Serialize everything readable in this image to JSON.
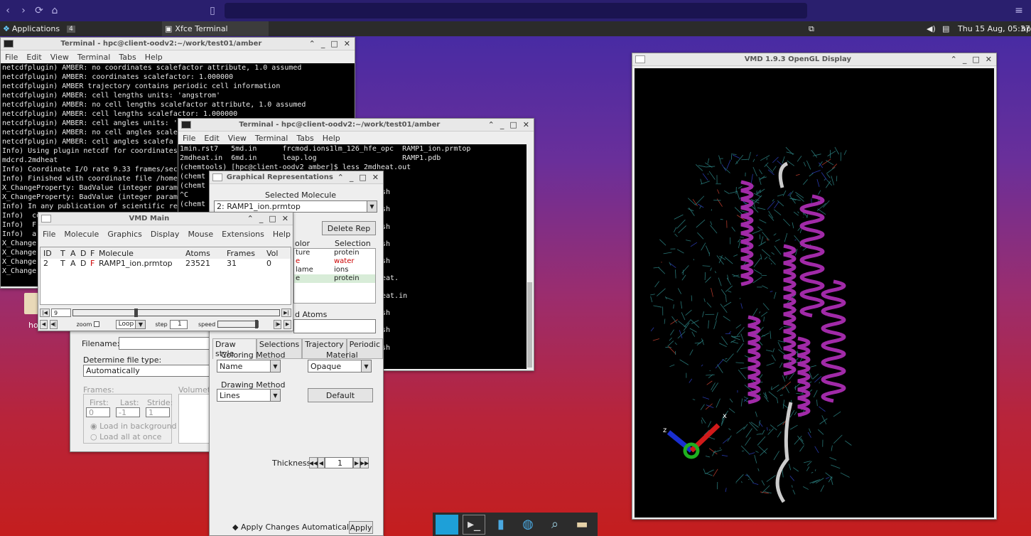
{
  "panel": {
    "apps": "Applications",
    "xfce": "Xfce Terminal",
    "clock": "Thu 15 Aug, 05:37",
    "user": "hpc",
    "badge": "4"
  },
  "term1": {
    "title": "Terminal - hpc@client-oodv2:~/work/test01/amber",
    "menu": [
      "File",
      "Edit",
      "View",
      "Terminal",
      "Tabs",
      "Help"
    ],
    "lines": [
      "netcdfplugin) AMBER: no coordinates scalefactor attribute, 1.0 assumed",
      "netcdfplugin) AMBER: coordinates scalefactor: 1.000000",
      "netcdfplugin) AMBER trajectory contains periodic cell information",
      "netcdfplugin) AMBER: cell lengths units: 'angstrom'",
      "netcdfplugin) AMBER: no cell lengths scalefactor attribute, 1.0 assumed",
      "netcdfplugin) AMBER: cell lengths scalefactor: 1.000000",
      "netcdfplugin) AMBER: cell angles units: '",
      "netcdfplugin) AMBER: no cell angles scale",
      "netcdfplugin) AMBER: cell angles scalefa",
      "Info) Using plugin netcdf for coordinates",
      "mdcrd.2mdheat",
      "Info) Coordinate I/O rate 9.33 frames/sec",
      "Info) Finished with coordinate file /home",
      "X_ChangeProperty: BadValue (integer param",
      "X_ChangeProperty: BadValue (integer param",
      "Info) In any publication of scientific re",
      "Info)  co",
      "Info)  F",
      "Info)  a",
      "X_Change",
      "X_Change",
      "X_Change",
      "X_Change"
    ]
  },
  "term2": {
    "title": "Terminal - hpc@client-oodv2:~/work/test01/amber",
    "menu": [
      "File",
      "Edit",
      "View",
      "Terminal",
      "Tabs",
      "Help"
    ],
    "lines": [
      "1min.rst7   5md.in      frcmod.ions1lm_126_hfe_opc  RAMP1_ion.prmtop",
      "2mdheat.in  6md.in      leap.log                    RAMP1.pdb",
      "(chemtools) [hpc@client-oodv2 amber]$ less 2mdheat.out",
      "(chemt",
      "(chemt",
      "^C",
      "(chemt"
    ],
    "right": [
      "sh",
      "sh",
      "sh",
      "sh",
      "sh",
      "eat.",
      "eat.in",
      "sh",
      "sh",
      "sh"
    ]
  },
  "filewin": {
    "filename_label": "Filename:",
    "determine_label": "Determine file type:",
    "determine_value": "Automatically",
    "frames_label": "Frames:",
    "first_label": "First:",
    "last_label": "Last:",
    "stride_label": "Stride:",
    "first_val": "0",
    "last_val": "-1",
    "stride_val": "1",
    "bg_label": "Load in background",
    "all_label": "Load all at once",
    "volumetric": "Volumetri"
  },
  "graph": {
    "title": "Graphical Representations",
    "selected_label": "Selected Molecule",
    "selected_value": "2: RAMP1_ion.prmtop",
    "delete_btn": "Delete Rep",
    "col_color": "olor",
    "col_sel": "Selection",
    "reps": [
      {
        "style": "ture",
        "color": "",
        "sel": "protein",
        "col": "#222"
      },
      {
        "style": "e",
        "color": "",
        "sel": "water",
        "col": "#c00"
      },
      {
        "style": "lame",
        "color": "",
        "sel": "ions",
        "col": "#222"
      },
      {
        "style": "e",
        "color": "",
        "sel": "protein",
        "col": "#222"
      }
    ],
    "atoms_label": "d Atoms",
    "tabs": [
      "Draw style",
      "Selections",
      "Trajectory",
      "Periodic"
    ],
    "coloring_label": "Coloring Method",
    "coloring_value": "Name",
    "material_label": "Material",
    "material_value": "Opaque",
    "drawing_label": "Drawing Method",
    "drawing_value": "Lines",
    "default_btn": "Default",
    "thickness_label": "Thickness",
    "thickness_value": "1",
    "apply_auto": "Apply Changes Automatically",
    "apply_btn": "Apply"
  },
  "vmdmain": {
    "title": "VMD Main",
    "menu": [
      "File",
      "Molecule",
      "Graphics",
      "Display",
      "Mouse",
      "Extensions",
      "Help"
    ],
    "headers": [
      "ID",
      "T",
      "A",
      "D",
      "F",
      "Molecule",
      "Atoms",
      "Frames",
      "Vol"
    ],
    "row": [
      "2",
      "T",
      "A",
      "D",
      "F",
      "RAMP1_ion.prmtop",
      "23521",
      "31",
      "0"
    ],
    "frame": "9",
    "zoom": "zoom",
    "loop": "Loop",
    "step": "step",
    "step_val": "1",
    "speed": "speed"
  },
  "vmdgl": {
    "title": "VMD 1.9.3 OpenGL Display",
    "axis_x": "x",
    "axis_z": "z"
  },
  "desktop": {
    "home": "ho"
  }
}
